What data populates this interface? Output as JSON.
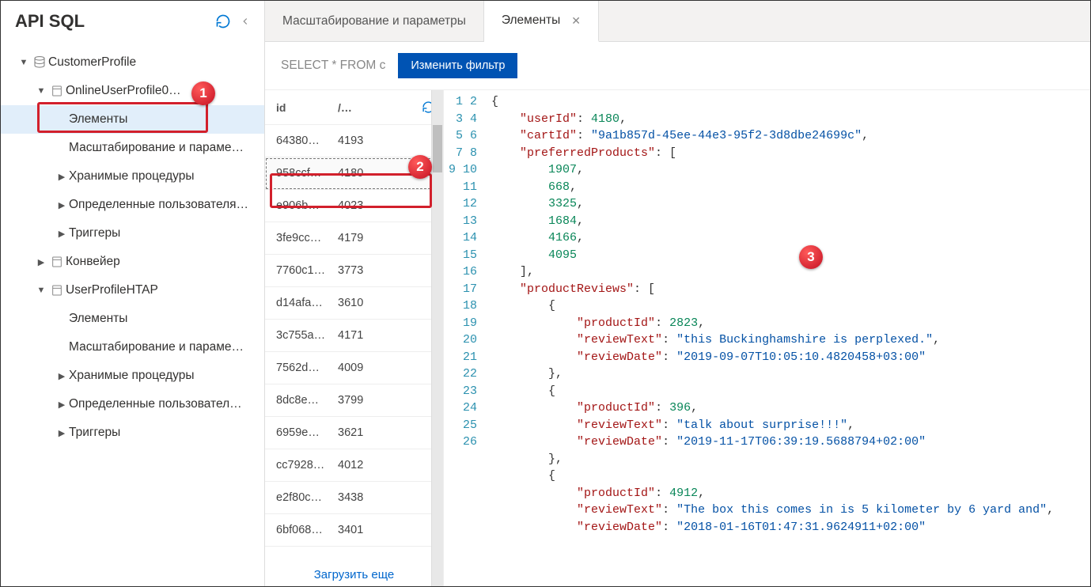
{
  "sidebar": {
    "title": "API SQL",
    "tree": {
      "db": "CustomerProfile",
      "container1": "OnlineUserProfile0…",
      "c1_items": "Элементы",
      "c1_scale": "Масштабирование и параме…",
      "c1_sprocs": "Хранимые процедуры",
      "c1_udf": "Определенные пользователя…",
      "c1_triggers": "Триггеры",
      "container2": "Конвейер",
      "container3": "UserProfileHTAP",
      "c3_items": "Элементы",
      "c3_scale": "Масштабирование и параме…",
      "c3_sprocs": "Хранимые процедуры",
      "c3_udf": "Определенные пользовател…",
      "c3_triggers": "Триггеры"
    }
  },
  "tabs": {
    "scale": "Масштабирование и параметры",
    "items": "Элементы"
  },
  "filter": {
    "query": "SELECT * FROM c",
    "edit_btn": "Изменить фильтр"
  },
  "items_header": {
    "id": "id",
    "pk": "/…"
  },
  "items": [
    {
      "id": "64380…",
      "pk": "4193"
    },
    {
      "id": "958ccf…",
      "pk": "4180"
    },
    {
      "id": "e906b…",
      "pk": "4023"
    },
    {
      "id": "3fe9cc…",
      "pk": "4179"
    },
    {
      "id": "7760c1…",
      "pk": "3773"
    },
    {
      "id": "d14afa…",
      "pk": "3610"
    },
    {
      "id": "3c755a…",
      "pk": "4171"
    },
    {
      "id": "7562d…",
      "pk": "4009"
    },
    {
      "id": "8dc8e…",
      "pk": "3799"
    },
    {
      "id": "6959e…",
      "pk": "3621"
    },
    {
      "id": "cc7928…",
      "pk": "4012"
    },
    {
      "id": "e2f80c…",
      "pk": "3438"
    },
    {
      "id": "6bf068…",
      "pk": "3401"
    }
  ],
  "load_more": "Загрузить еще",
  "json": {
    "userId": 4180,
    "cartId": "9a1b857d-45ee-44e3-95f2-3d8dbe24699c",
    "preferredProducts": [
      1907,
      668,
      3325,
      1684,
      4166,
      4095
    ],
    "productReviews": [
      {
        "productId": 2823,
        "reviewText": "this Buckinghamshire is perplexed.",
        "reviewDate": "2019-09-07T10:05:10.4820458+03:00"
      },
      {
        "productId": 396,
        "reviewText": "talk about surprise!!!",
        "reviewDate": "2019-11-17T06:39:19.5688794+02:00"
      },
      {
        "productId": 4912,
        "reviewText": "The box this comes in is 5 kilometer by 6 yard and",
        "reviewDate": "2018-01-16T01:47:31.9624911+02:00"
      }
    ]
  },
  "callouts": {
    "1": "1",
    "2": "2",
    "3": "3"
  }
}
